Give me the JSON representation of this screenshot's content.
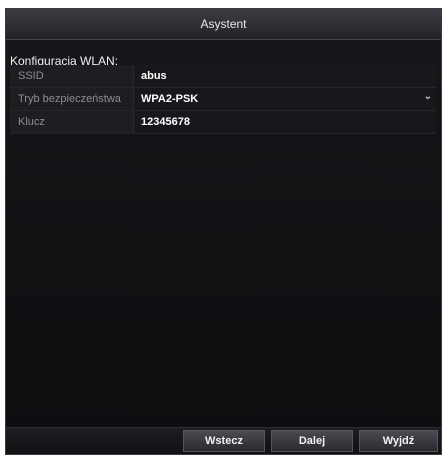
{
  "dialog": {
    "title": "Asystent"
  },
  "section": {
    "title": "Konfiguracja WLAN:"
  },
  "fields": [
    {
      "label": "SSID",
      "value": "abus"
    },
    {
      "label": "Tryb bezpieczeństwa",
      "value": "WPA2-PSK"
    },
    {
      "label": "Klucz",
      "value": "12345678"
    }
  ],
  "buttons": {
    "back": "Wstecz",
    "next": "Dalej",
    "exit": "Wyjdź"
  },
  "icons": {
    "dropdown": "chevron-down-icon"
  }
}
